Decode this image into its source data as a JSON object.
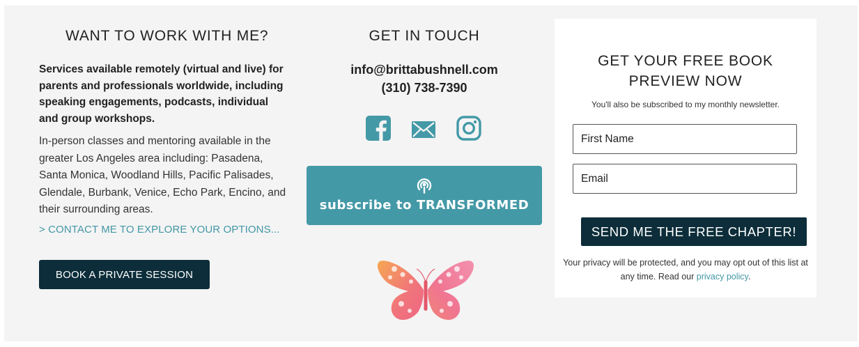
{
  "work": {
    "title": "WANT TO WORK WITH ME?",
    "services": "Services available remotely (virtual and live) for parents and professionals worldwide, including speaking engagements, podcasts, individual and group workshops.",
    "inperson": "In-person classes and mentoring available in the greater Los Angeles area including: Pasadena, Santa Monica, Woodland Hills, Pacific Palisades, Glendale, Burbank, Venice, Echo Park, Encino, and their surrounding areas.",
    "contact_link": "> CONTACT ME TO EXPLORE YOUR OPTIONS...",
    "book_button": "BOOK A PRIVATE SESSION"
  },
  "touch": {
    "title": "GET IN TOUCH",
    "email": "info@brittabushnell.com",
    "phone": "(310) 738-7390",
    "social_icons": [
      "facebook-icon",
      "mail-icon",
      "instagram-icon"
    ],
    "podcast_label": "subscribe to TRANSFORMED",
    "podcast_icon": "podcast-icon"
  },
  "form": {
    "title_line1": "GET YOUR FREE BOOK",
    "title_line2": "PREVIEW NOW",
    "subtitle": "You'll also be subscribed to my monthly newsletter.",
    "first_name_placeholder": "First Name",
    "email_placeholder": "Email",
    "submit": "SEND ME THE FREE CHAPTER!",
    "privacy_text": "Your privacy will be protected, and you may opt out of this list at any time. Read our ",
    "privacy_link": "privacy policy",
    "privacy_end": "."
  },
  "colors": {
    "accent": "#4499a7",
    "dark_button": "#0c2d39",
    "background": "#f4f4f4"
  }
}
